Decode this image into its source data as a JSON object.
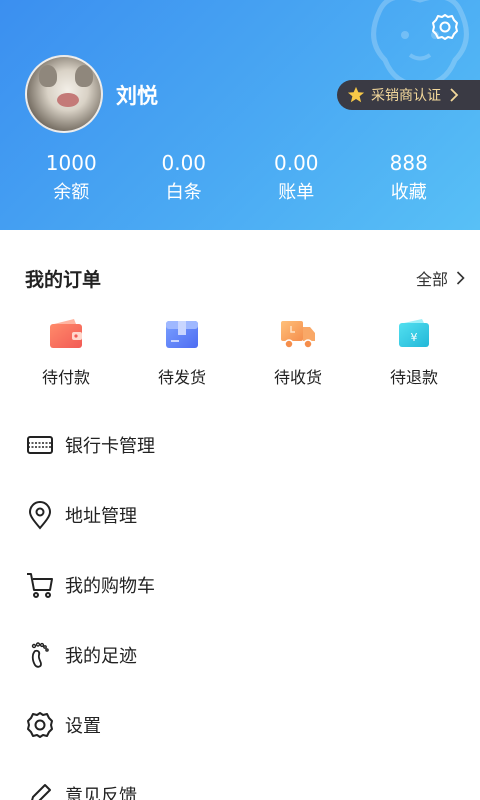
{
  "profile": {
    "username": "刘悦",
    "cert_label": "采销商认证"
  },
  "stats": [
    {
      "value": "1000",
      "label": "余额"
    },
    {
      "value": "0.00",
      "label": "白条"
    },
    {
      "value": "0.00",
      "label": "账单"
    },
    {
      "value": "888",
      "label": "收藏"
    }
  ],
  "orders": {
    "title": "我的订单",
    "all_label": "全部",
    "items": [
      {
        "label": "待付款",
        "icon": "wallet-icon",
        "color": "#f9735f"
      },
      {
        "label": "待发货",
        "icon": "package-icon",
        "color": "#5c7cf6"
      },
      {
        "label": "待收货",
        "icon": "truck-icon",
        "color": "#f8a25b"
      },
      {
        "label": "待退款",
        "icon": "refund-icon",
        "color": "#2fc7e2"
      }
    ]
  },
  "menu": [
    {
      "label": "银行卡管理",
      "icon": "bank-card-icon"
    },
    {
      "label": "地址管理",
      "icon": "location-pin-icon"
    },
    {
      "label": "我的购物车",
      "icon": "shopping-cart-icon"
    },
    {
      "label": "我的足迹",
      "icon": "footprint-icon"
    },
    {
      "label": "设置",
      "icon": "gear-icon"
    },
    {
      "label": "意见反馈",
      "icon": "pencil-icon"
    }
  ],
  "colors": {
    "header_start": "#3b8ff0",
    "header_end": "#58c0f6",
    "cert_bg": "#3a3a44",
    "cert_text": "#f3d89b",
    "star": "#f8c948"
  }
}
